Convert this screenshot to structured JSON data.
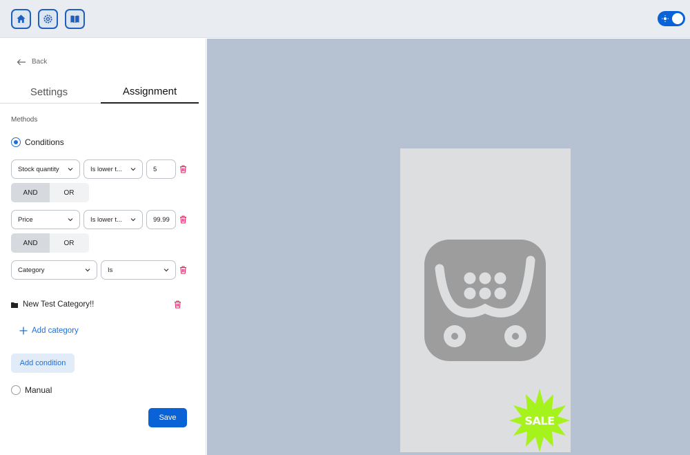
{
  "topbar": {
    "buttons": [
      {
        "icon": "home-icon"
      },
      {
        "icon": "gear-icon"
      },
      {
        "icon": "book-icon"
      }
    ],
    "theme_toggle": {
      "icon": "sun-icon",
      "state": "on",
      "color": "#0a63d6"
    }
  },
  "sidebar": {
    "back_label": "Back",
    "tabs": [
      {
        "label": "Settings",
        "active": false
      },
      {
        "label": "Assignment",
        "active": true
      }
    ],
    "methods_label": "Methods",
    "method_conditions_label": "Conditions",
    "conditions": [
      {
        "field": "Stock quantity",
        "operator": "Is lower t...",
        "value": "5"
      },
      {
        "field": "Price",
        "operator": "Is lower t...",
        "value": "99.99"
      },
      {
        "field": "Category",
        "operator": "Is"
      }
    ],
    "connectors": [
      {
        "and": "AND",
        "or": "OR",
        "selected": "AND"
      },
      {
        "and": "AND",
        "or": "OR",
        "selected": "AND"
      }
    ],
    "category_item": "New Test Category!!",
    "add_category_label": "Add category",
    "add_condition_label": "Add condition",
    "method_manual_label": "Manual",
    "save_label": "Save"
  },
  "preview": {
    "badge_text": "SALE",
    "badge_color": "#a6f21c",
    "background": "#b6c2d1"
  }
}
